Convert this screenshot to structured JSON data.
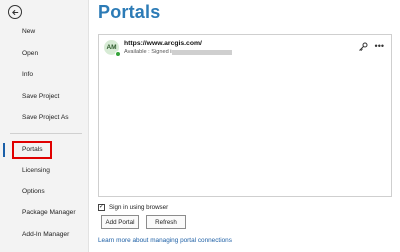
{
  "sidebar": {
    "items": [
      {
        "label": "New"
      },
      {
        "label": "Open"
      },
      {
        "label": "Info"
      },
      {
        "label": "Save Project"
      },
      {
        "label": "Save Project As"
      },
      {
        "label": "Portals"
      },
      {
        "label": "Licensing"
      },
      {
        "label": "Options"
      },
      {
        "label": "Package Manager"
      },
      {
        "label": "Add-In Manager"
      }
    ],
    "active": "Portals"
  },
  "main": {
    "title": "Portals",
    "portals": [
      {
        "initials": "AM",
        "url": "https://www.arcgis.com/",
        "status": "Available : Signed in as"
      }
    ],
    "sign_in_browser_label": "Sign in using browser",
    "sign_in_browser_checked": true,
    "add_portal_label": "Add Portal",
    "refresh_label": "Refresh",
    "learn_more_link": "Learn more about managing portal connections"
  },
  "colors": {
    "accent": "#2c7bb6",
    "highlight": "#e00000",
    "status_ok": "#35a33a"
  }
}
